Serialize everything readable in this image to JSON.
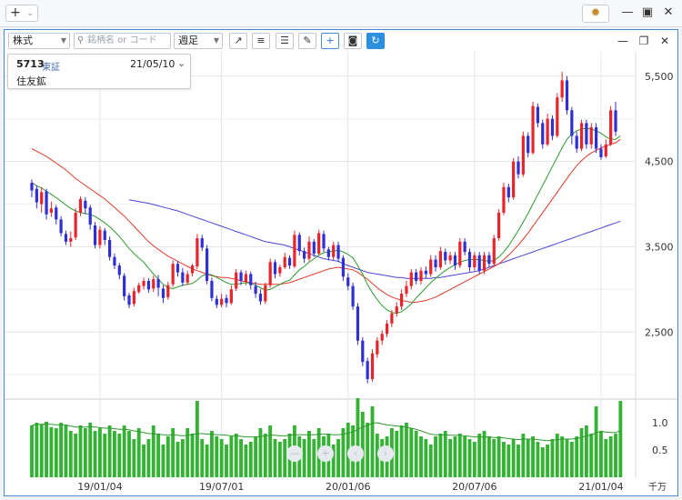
{
  "titlebar": {
    "add_label": "+",
    "gear_icon": "gear-icon"
  },
  "toolbar": {
    "market": "株式",
    "search_placeholder": "銘柄名 or コード",
    "period": "週足"
  },
  "info": {
    "code": "5713",
    "exchange": "東証",
    "date": "21/05/10",
    "name": "住友鉱"
  },
  "colors": {
    "up": "#e8242c",
    "down": "#2f2fd4",
    "ma_short": "#2e9a2e",
    "ma_mid": "#e33a2a",
    "ma_long": "#4a46d8",
    "volume": "#33b233",
    "accent": "#4a8bd6"
  },
  "chart_data": {
    "type": "candlestick",
    "price": {
      "yticks": [
        "5,500",
        "4,500",
        "3,500",
        "2,500"
      ],
      "ylim": [
        1800,
        5700
      ],
      "x_start_date": "2018-10-01",
      "candles": [
        [
          4250,
          4160,
          4290,
          4080
        ],
        [
          4180,
          4020,
          4220,
          3950
        ],
        [
          4000,
          4140,
          4200,
          3900
        ],
        [
          4150,
          3880,
          4180,
          3820
        ],
        [
          3900,
          3950,
          4030,
          3850
        ],
        [
          3960,
          3820,
          3990,
          3760
        ],
        [
          3820,
          3660,
          3860,
          3620
        ],
        [
          3650,
          3560,
          3690,
          3520
        ],
        [
          3560,
          3600,
          3680,
          3500
        ],
        [
          3610,
          3900,
          3950,
          3580
        ],
        [
          3900,
          4060,
          4090,
          3860
        ],
        [
          4040,
          3950,
          4080,
          3880
        ],
        [
          3960,
          3760,
          3990,
          3700
        ],
        [
          3750,
          3520,
          3790,
          3480
        ],
        [
          3520,
          3700,
          3740,
          3480
        ],
        [
          3690,
          3580,
          3720,
          3520
        ],
        [
          3580,
          3380,
          3620,
          3340
        ],
        [
          3380,
          3280,
          3420,
          3240
        ],
        [
          3280,
          3170,
          3310,
          3120
        ],
        [
          3160,
          2920,
          3190,
          2870
        ],
        [
          2930,
          2820,
          2960,
          2780
        ],
        [
          2830,
          2980,
          3020,
          2800
        ],
        [
          2970,
          3050,
          3080,
          2950
        ],
        [
          3040,
          3100,
          3140,
          3000
        ],
        [
          3100,
          3000,
          3130,
          2960
        ],
        [
          3010,
          3120,
          3160,
          2970
        ],
        [
          3120,
          3020,
          3170,
          2920
        ],
        [
          3010,
          2900,
          3050,
          2840
        ],
        [
          2910,
          3050,
          3090,
          2880
        ],
        [
          3060,
          3300,
          3340,
          3030
        ],
        [
          3300,
          3200,
          3330,
          3150
        ],
        [
          3200,
          3080,
          3250,
          3040
        ],
        [
          3080,
          3180,
          3220,
          3050
        ],
        [
          3190,
          3280,
          3300,
          3150
        ],
        [
          3270,
          3600,
          3650,
          3240
        ],
        [
          3600,
          3490,
          3640,
          3450
        ],
        [
          3480,
          3100,
          3520,
          3060
        ],
        [
          3100,
          2900,
          3140,
          2860
        ],
        [
          2890,
          2820,
          2930,
          2780
        ],
        [
          2820,
          2890,
          2950,
          2790
        ],
        [
          2900,
          2840,
          2940,
          2790
        ],
        [
          2840,
          3000,
          3050,
          2820
        ],
        [
          3010,
          3200,
          3240,
          2980
        ],
        [
          3200,
          3100,
          3230,
          3050
        ],
        [
          3090,
          3180,
          3220,
          3050
        ],
        [
          3180,
          3050,
          3210,
          3000
        ],
        [
          3040,
          2950,
          3090,
          2900
        ],
        [
          2950,
          2860,
          3000,
          2820
        ],
        [
          2860,
          3050,
          3080,
          2830
        ],
        [
          3050,
          3320,
          3360,
          3020
        ],
        [
          3320,
          3180,
          3350,
          3130
        ],
        [
          3190,
          3260,
          3290,
          3150
        ],
        [
          3260,
          3380,
          3430,
          3240
        ],
        [
          3370,
          3280,
          3400,
          3240
        ],
        [
          3270,
          3640,
          3690,
          3250
        ],
        [
          3640,
          3450,
          3670,
          3400
        ],
        [
          3450,
          3360,
          3490,
          3310
        ],
        [
          3360,
          3560,
          3620,
          3330
        ],
        [
          3560,
          3420,
          3590,
          3380
        ],
        [
          3420,
          3660,
          3700,
          3400
        ],
        [
          3650,
          3480,
          3690,
          3440
        ],
        [
          3470,
          3380,
          3500,
          3340
        ],
        [
          3380,
          3520,
          3560,
          3340
        ],
        [
          3520,
          3360,
          3560,
          3320
        ],
        [
          3370,
          3150,
          3400,
          3100
        ],
        [
          3140,
          3040,
          3190,
          2990
        ],
        [
          3040,
          2800,
          3080,
          2760
        ],
        [
          2800,
          2400,
          2840,
          2350
        ],
        [
          2400,
          2150,
          2440,
          2100
        ],
        [
          2160,
          1950,
          2200,
          1900
        ],
        [
          1950,
          2250,
          2300,
          1920
        ],
        [
          2240,
          2400,
          2440,
          2200
        ],
        [
          2400,
          2480,
          2520,
          2350
        ],
        [
          2480,
          2600,
          2640,
          2440
        ],
        [
          2600,
          2720,
          2760,
          2560
        ],
        [
          2720,
          2800,
          2850,
          2680
        ],
        [
          2800,
          2950,
          3000,
          2760
        ],
        [
          2950,
          3040,
          3100,
          2910
        ],
        [
          3040,
          3200,
          3240,
          3000
        ],
        [
          3200,
          3100,
          3240,
          3060
        ],
        [
          3100,
          3220,
          3260,
          3060
        ],
        [
          3220,
          3180,
          3270,
          3130
        ],
        [
          3180,
          3350,
          3400,
          3150
        ],
        [
          3350,
          3260,
          3400,
          3210
        ],
        [
          3260,
          3450,
          3500,
          3230
        ],
        [
          3440,
          3340,
          3480,
          3290
        ],
        [
          3340,
          3400,
          3440,
          3300
        ],
        [
          3400,
          3280,
          3440,
          3230
        ],
        [
          3280,
          3560,
          3600,
          3250
        ],
        [
          3560,
          3440,
          3600,
          3400
        ],
        [
          3440,
          3260,
          3480,
          3210
        ],
        [
          3260,
          3400,
          3440,
          3220
        ],
        [
          3400,
          3220,
          3440,
          3180
        ],
        [
          3220,
          3400,
          3440,
          3180
        ],
        [
          3400,
          3300,
          3440,
          3260
        ],
        [
          3300,
          3600,
          3640,
          3280
        ],
        [
          3600,
          3900,
          3940,
          3570
        ],
        [
          3900,
          4200,
          4250,
          3870
        ],
        [
          4200,
          4080,
          4240,
          4020
        ],
        [
          4080,
          4500,
          4540,
          4050
        ],
        [
          4500,
          4350,
          4560,
          4300
        ],
        [
          4350,
          4800,
          4850,
          4320
        ],
        [
          4800,
          4600,
          4840,
          4550
        ],
        [
          4600,
          5150,
          5200,
          4580
        ],
        [
          5140,
          4950,
          5180,
          4900
        ],
        [
          4950,
          4700,
          4990,
          4650
        ],
        [
          4700,
          5000,
          5060,
          4680
        ],
        [
          5000,
          4800,
          5040,
          4750
        ],
        [
          4800,
          5250,
          5300,
          4780
        ],
        [
          5250,
          5450,
          5550,
          5200
        ],
        [
          5450,
          5100,
          5500,
          5050
        ],
        [
          5100,
          4800,
          5140,
          4700
        ],
        [
          4800,
          4650,
          4850,
          4600
        ],
        [
          4650,
          4950,
          4990,
          4620
        ],
        [
          4950,
          4700,
          4990,
          4650
        ],
        [
          4700,
          4900,
          4950,
          4650
        ],
        [
          4900,
          4650,
          4950,
          4600
        ],
        [
          4650,
          4550,
          4700,
          4520
        ],
        [
          4560,
          4700,
          4760,
          4540
        ],
        [
          4700,
          5100,
          5150,
          4680
        ],
        [
          5100,
          4850,
          5200,
          4800
        ]
      ],
      "ma13": [
        4250,
        4215,
        4190,
        4150,
        4115,
        4075,
        4035,
        3990,
        3950,
        3920,
        3900,
        3890,
        3880,
        3855,
        3820,
        3780,
        3735,
        3680,
        3620,
        3550,
        3480,
        3420,
        3370,
        3320,
        3250,
        3180,
        3120,
        3060,
        3020,
        3010,
        3030,
        3050,
        3060,
        3070,
        3110,
        3160,
        3180,
        3170,
        3140,
        3110,
        3080,
        3060,
        3060,
        3070,
        3080,
        3070,
        3050,
        3020,
        2990,
        3000,
        3030,
        3060,
        3090,
        3110,
        3170,
        3230,
        3270,
        3320,
        3360,
        3400,
        3430,
        3440,
        3450,
        3460,
        3440,
        3410,
        3370,
        3280,
        3180,
        3060,
        2960,
        2880,
        2810,
        2760,
        2730,
        2720,
        2740,
        2780,
        2830,
        2900,
        2960,
        3020,
        3080,
        3130,
        3180,
        3220,
        3260,
        3290,
        3320,
        3340,
        3350,
        3350,
        3350,
        3340,
        3330,
        3340,
        3380,
        3440,
        3510,
        3600,
        3690,
        3790,
        3890,
        4000,
        4110,
        4220,
        4330,
        4440,
        4550,
        4660,
        4760,
        4820,
        4860,
        4880,
        4890,
        4880,
        4860,
        4830,
        4790,
        4760,
        4760,
        4800
      ],
      "ma26": [
        4650,
        4620,
        4590,
        4560,
        4520,
        4480,
        4440,
        4400,
        4350,
        4300,
        4260,
        4220,
        4180,
        4140,
        4100,
        4060,
        4010,
        3960,
        3910,
        3860,
        3800,
        3740,
        3680,
        3620,
        3560,
        3510,
        3470,
        3430,
        3390,
        3360,
        3330,
        3300,
        3270,
        3240,
        3220,
        3200,
        3180,
        3160,
        3150,
        3140,
        3140,
        3130,
        3120,
        3100,
        3090,
        3080,
        3070,
        3060,
        3060,
        3060,
        3060,
        3060,
        3070,
        3080,
        3100,
        3120,
        3140,
        3160,
        3180,
        3200,
        3220,
        3240,
        3250,
        3260,
        3250,
        3240,
        3230,
        3200,
        3160,
        3120,
        3070,
        3020,
        2980,
        2940,
        2910,
        2890,
        2870,
        2860,
        2850,
        2850,
        2860,
        2870,
        2890,
        2910,
        2940,
        2970,
        3000,
        3030,
        3060,
        3090,
        3120,
        3150,
        3180,
        3210,
        3240,
        3270,
        3300,
        3350,
        3400,
        3460,
        3520,
        3590,
        3660,
        3740,
        3820,
        3900,
        3980,
        4060,
        4140,
        4220,
        4300,
        4380,
        4450,
        4510,
        4560,
        4600,
        4630,
        4660,
        4680,
        4700,
        4720,
        4760
      ],
      "ma52": [
        null,
        null,
        null,
        null,
        null,
        null,
        null,
        null,
        null,
        null,
        null,
        null,
        null,
        null,
        null,
        null,
        null,
        null,
        null,
        null,
        4050,
        4040,
        4030,
        4020,
        4010,
        3995,
        3980,
        3965,
        3950,
        3935,
        3920,
        3900,
        3880,
        3860,
        3840,
        3820,
        3800,
        3780,
        3760,
        3740,
        3720,
        3700,
        3680,
        3660,
        3640,
        3620,
        3600,
        3580,
        3560,
        3550,
        3540,
        3530,
        3520,
        3500,
        3480,
        3460,
        3440,
        3420,
        3400,
        3380,
        3360,
        3350,
        3340,
        3330,
        3300,
        3280,
        3260,
        3240,
        3220,
        3200,
        3190,
        3180,
        3170,
        3160,
        3150,
        3140,
        3140,
        3130,
        3130,
        3130,
        3130,
        3130,
        3130,
        3140,
        3140,
        3150,
        3160,
        3170,
        3180,
        3190,
        3200,
        3210,
        3220,
        3240,
        3260,
        3280,
        3300,
        3320,
        3340,
        3360,
        3380,
        3400,
        3420,
        3440,
        3460,
        3480,
        3500,
        3520,
        3540,
        3560,
        3580,
        3600,
        3620,
        3640,
        3660,
        3680,
        3700,
        3720,
        3740,
        3760,
        3780,
        3800
      ]
    },
    "volume": {
      "yticks": [
        "1.0",
        "0.5"
      ],
      "unit": "千万",
      "ylim": [
        0,
        1.4
      ],
      "values": [
        0.95,
        1.0,
        0.97,
        1.02,
        0.92,
        0.9,
        1.0,
        0.95,
        0.85,
        0.8,
        0.95,
        0.9,
        1.0,
        0.85,
        0.9,
        0.8,
        0.95,
        0.85,
        0.8,
        0.95,
        0.85,
        0.7,
        0.9,
        0.6,
        0.7,
        0.95,
        0.8,
        0.6,
        0.75,
        0.9,
        0.65,
        0.7,
        0.9,
        0.8,
        1.4,
        0.7,
        0.6,
        0.85,
        0.75,
        0.7,
        0.6,
        0.75,
        0.8,
        0.7,
        0.6,
        0.65,
        0.75,
        0.9,
        0.8,
        0.95,
        0.7,
        0.65,
        0.7,
        0.8,
        0.95,
        0.75,
        0.7,
        0.85,
        0.7,
        0.9,
        0.75,
        0.8,
        0.6,
        0.7,
        0.9,
        1.0,
        0.95,
        1.45,
        1.2,
        1.0,
        1.3,
        0.8,
        0.7,
        0.75,
        0.9,
        0.85,
        0.95,
        1.0,
        0.9,
        0.85,
        0.75,
        0.7,
        0.6,
        0.75,
        0.8,
        0.85,
        0.7,
        0.75,
        0.8,
        0.75,
        0.7,
        0.65,
        0.8,
        0.85,
        0.75,
        0.7,
        0.75,
        0.65,
        0.6,
        0.7,
        0.6,
        0.8,
        0.7,
        0.75,
        0.65,
        0.55,
        0.6,
        0.7,
        0.8,
        0.75,
        0.7,
        0.65,
        0.75,
        0.9,
        0.95,
        0.8,
        1.3,
        0.85,
        0.7,
        0.75,
        0.8,
        1.4
      ],
      "ma_short": [
        0.95,
        0.97,
        0.97,
        0.98,
        0.97,
        0.96,
        0.96,
        0.96,
        0.94,
        0.92,
        0.92,
        0.92,
        0.93,
        0.92,
        0.91,
        0.9,
        0.9,
        0.89,
        0.88,
        0.88,
        0.87,
        0.85,
        0.84,
        0.82,
        0.8,
        0.8,
        0.79,
        0.78,
        0.77,
        0.78,
        0.77,
        0.76,
        0.77,
        0.78,
        0.8,
        0.8,
        0.79,
        0.79,
        0.78,
        0.78,
        0.77,
        0.76,
        0.76,
        0.75,
        0.74,
        0.74,
        0.74,
        0.75,
        0.76,
        0.77,
        0.77,
        0.76,
        0.76,
        0.77,
        0.78,
        0.78,
        0.78,
        0.78,
        0.78,
        0.79,
        0.79,
        0.79,
        0.78,
        0.78,
        0.79,
        0.81,
        0.83,
        0.88,
        0.92,
        0.95,
        0.99,
        1.0,
        0.98,
        0.96,
        0.95,
        0.94,
        0.93,
        0.92,
        0.9,
        0.88,
        0.85,
        0.82,
        0.79,
        0.78,
        0.78,
        0.78,
        0.77,
        0.77,
        0.77,
        0.76,
        0.75,
        0.74,
        0.74,
        0.74,
        0.74,
        0.73,
        0.73,
        0.72,
        0.71,
        0.7,
        0.69,
        0.7,
        0.7,
        0.7,
        0.69,
        0.68,
        0.67,
        0.68,
        0.69,
        0.7,
        0.7,
        0.7,
        0.71,
        0.73,
        0.76,
        0.77,
        0.82,
        0.84,
        0.83,
        0.82,
        0.82,
        0.85
      ]
    },
    "xticks": [
      {
        "label": "19/01/04",
        "i": 14
      },
      {
        "label": "19/07/01",
        "i": 39
      },
      {
        "label": "20/01/06",
        "i": 65
      },
      {
        "label": "20/07/06",
        "i": 91
      },
      {
        "label": "21/01/04",
        "i": 117
      }
    ]
  }
}
